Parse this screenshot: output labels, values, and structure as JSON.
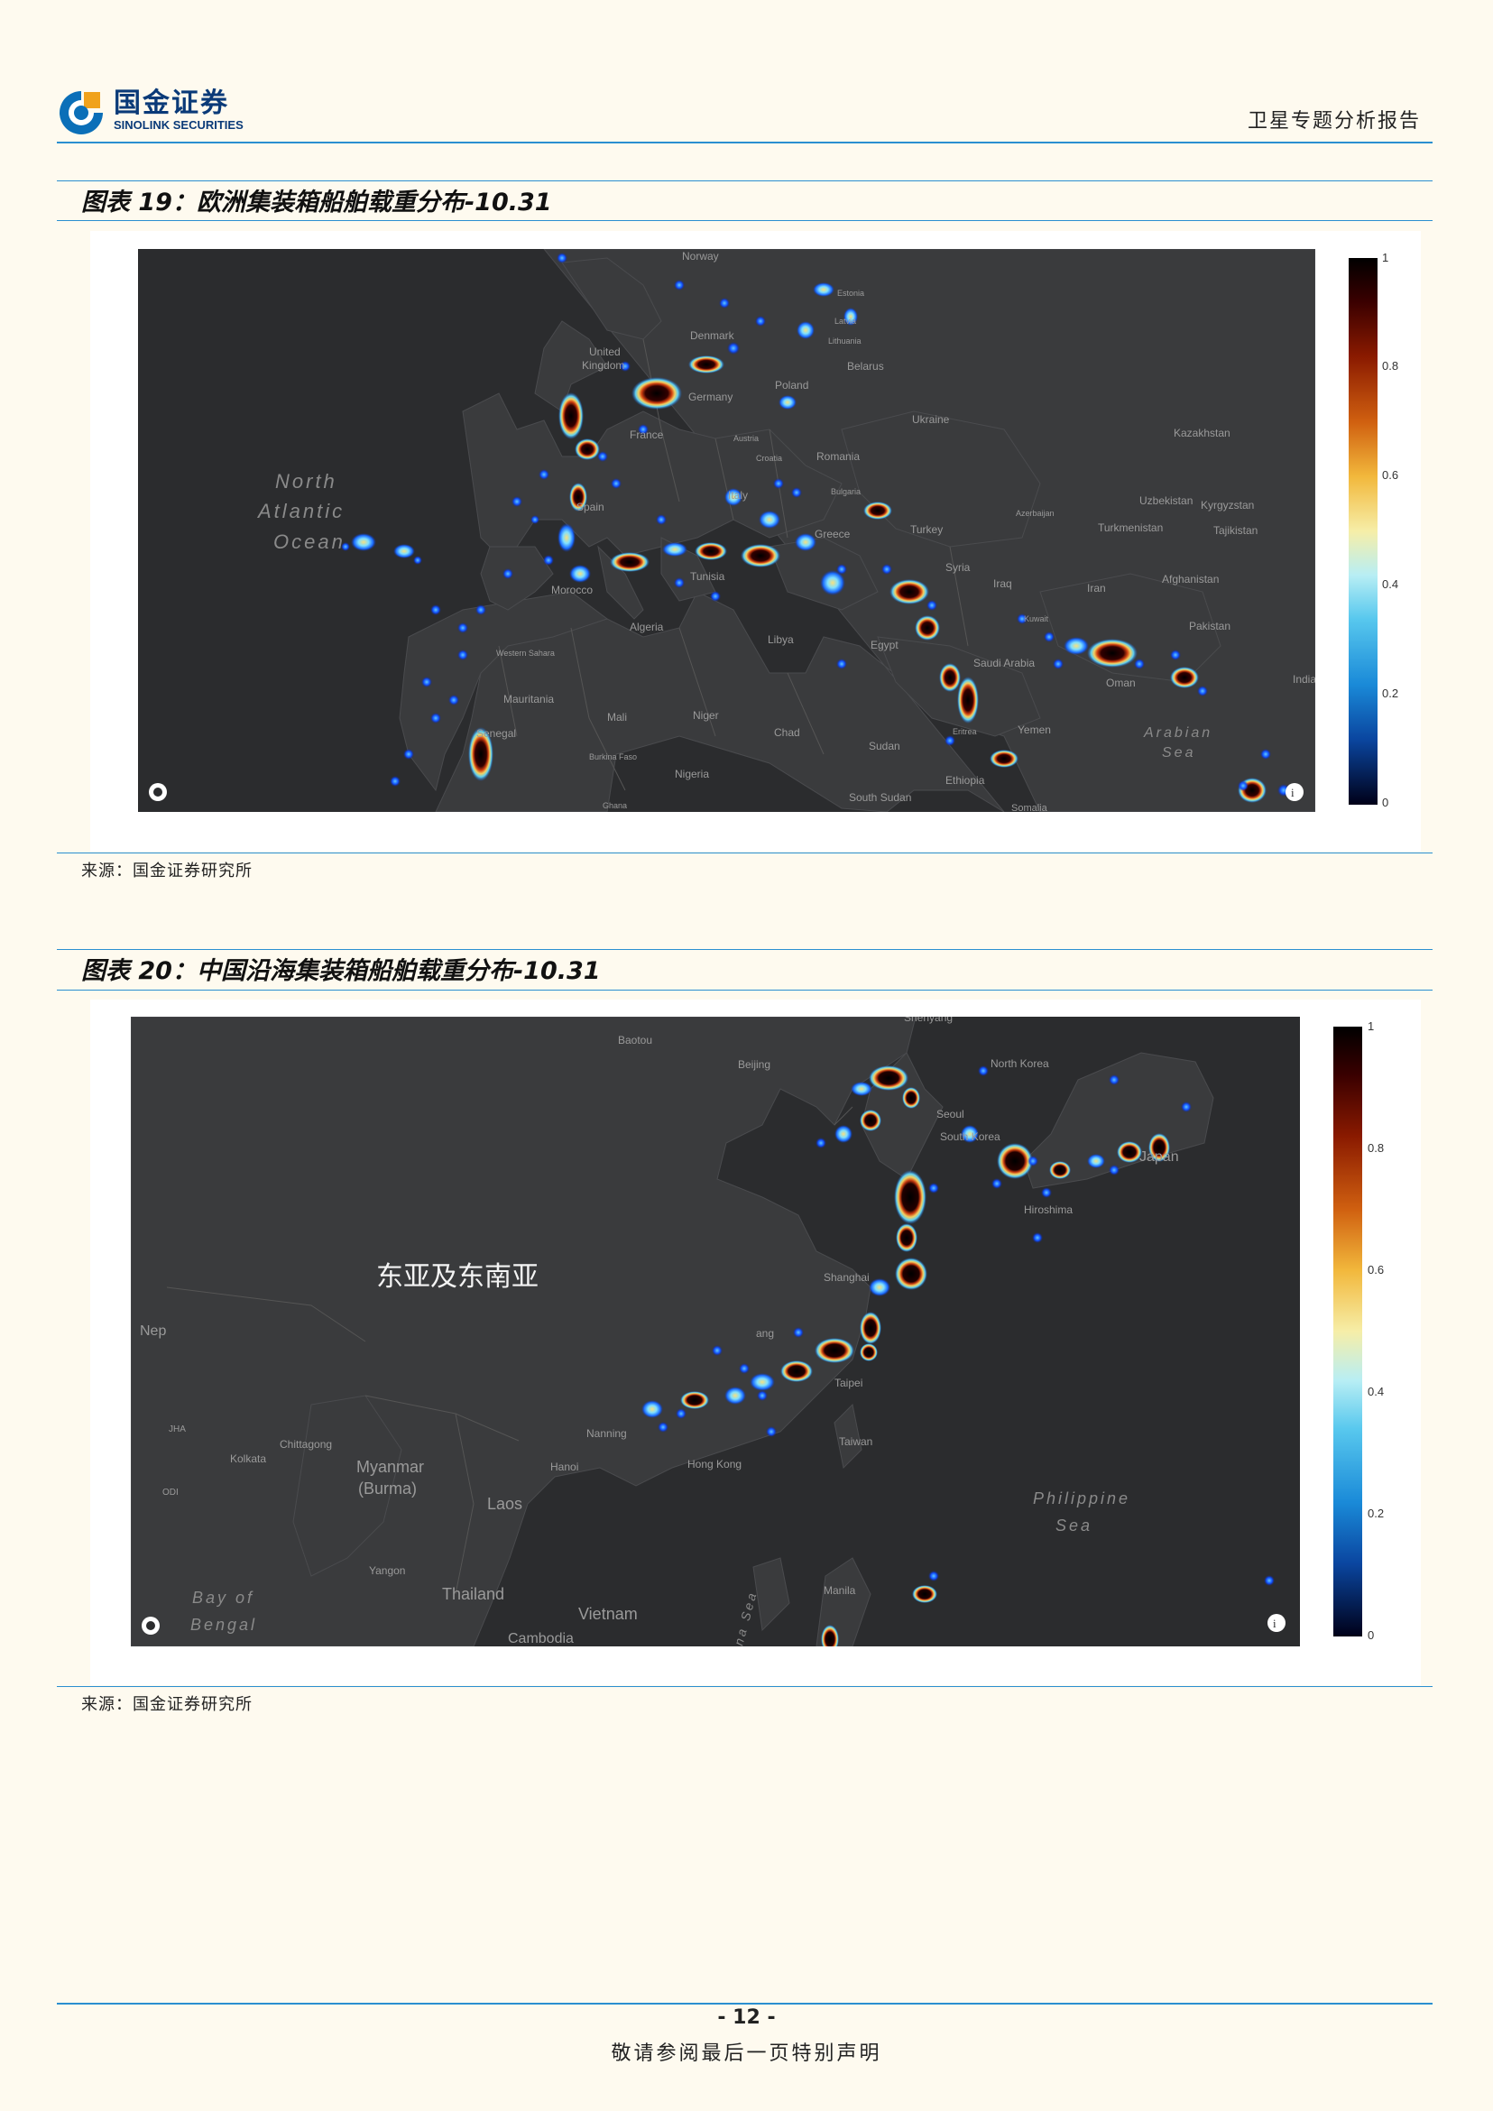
{
  "header": {
    "logo_cn": "国金证券",
    "logo_en": "SINOLINK SECURITIES",
    "report_title": "卫星专题分析报告"
  },
  "figures": [
    {
      "title": "图表 19：欧洲集装箱船舶载重分布-10.31",
      "source": "来源：国金证券研究所",
      "map_labels": [
        "Norway",
        "Estonia",
        "Latvia",
        "Denmark",
        "Lithuania",
        "United",
        "Kingdom",
        "Belarus",
        "Poland",
        "Germany",
        "Ukraine",
        "France",
        "Austria",
        "Croatia",
        "Romania",
        "Bulgaria",
        "Kazakhstan",
        "Italy",
        "Spain",
        "Uzbekistan",
        "Kyrgyzstan",
        "Azerbaijan",
        "Turkey",
        "Greece",
        "Turkmenistan",
        "Tajikistan",
        "Syria",
        "Tunisia",
        "Morocco",
        "Iraq",
        "Iran",
        "Afghanistan",
        "Algeria",
        "Kuwait",
        "Pakistan",
        "Western Sahara",
        "Libya",
        "Egypt",
        "Saudi Arabia",
        "Oman",
        "India",
        "Mauritania",
        "Mali",
        "Niger",
        "Chad",
        "Eritrea",
        "Yemen",
        "Senegal",
        "Sudan",
        "Burkina Faso",
        "Nigeria",
        "Ethiopia",
        "South Sudan",
        "Somalia",
        "Ghana"
      ],
      "sea_labels": [
        "North",
        "Atlantic",
        "Ocean",
        "Arabian",
        "Sea"
      ],
      "colorbar_ticks": [
        "1",
        "0.8",
        "0.6",
        "0.4",
        "0.2",
        "0"
      ]
    },
    {
      "title": "图表 20：中国沿海集装箱船舶载重分布-10.31",
      "source": "来源：国金证券研究所",
      "overlay_label": "东亚及东南亚",
      "map_labels": [
        "Shenyang",
        "Baotou",
        "Beijing",
        "North Korea",
        "Seoul",
        "South Korea",
        "Japan",
        "Hiroshima",
        "Shanghai",
        "Nep",
        "ang",
        "Taipei",
        "Taiwan",
        "JHA",
        "Chittagong",
        "Kolkata",
        "Nanning",
        "Myanmar",
        "(Burma)",
        "Hanoi",
        "Hong Kong",
        "ODI",
        "Laos",
        "Yangon",
        "Thailand",
        "Vietnam",
        "Manila",
        "Cambodia"
      ],
      "sea_labels": [
        "Philippine",
        "Sea",
        "Bay of",
        "Bengal",
        "na Sea"
      ],
      "colorbar_ticks": [
        "1",
        "0.8",
        "0.6",
        "0.4",
        "0.2",
        "0"
      ]
    }
  ],
  "footer": {
    "page_number": "- 12 -",
    "disclaimer": "敬请参阅最后一页特别声明"
  }
}
